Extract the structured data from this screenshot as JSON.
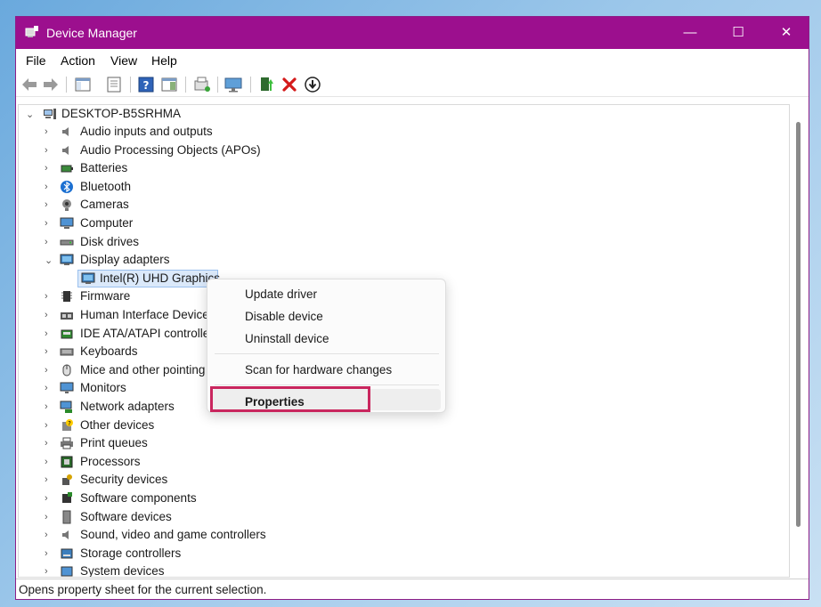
{
  "window": {
    "title": "Device Manager",
    "controls": {
      "minimize": "—",
      "maximize": "☐",
      "close": "✕"
    }
  },
  "menubar": [
    "File",
    "Action",
    "View",
    "Help"
  ],
  "toolbar": {
    "icons": [
      "back-icon",
      "forward-icon",
      "show-hide-console-tree-icon",
      "properties-icon",
      "help-icon",
      "action-pane-icon",
      "scan-hardware-icon",
      "monitor-icon",
      "update-driver-icon",
      "uninstall-icon",
      "download-icon"
    ]
  },
  "tree": {
    "root": "DESKTOP-B5SRHMA",
    "categories": [
      {
        "label": "Audio inputs and outputs",
        "icon": "speaker-icon",
        "expanded": false
      },
      {
        "label": "Audio Processing Objects (APOs)",
        "icon": "speaker-icon",
        "expanded": false
      },
      {
        "label": "Batteries",
        "icon": "battery-icon",
        "expanded": false
      },
      {
        "label": "Bluetooth",
        "icon": "bluetooth-icon",
        "expanded": false
      },
      {
        "label": "Cameras",
        "icon": "camera-icon",
        "expanded": false
      },
      {
        "label": "Computer",
        "icon": "computer-icon",
        "expanded": false
      },
      {
        "label": "Disk drives",
        "icon": "disk-icon",
        "expanded": false
      },
      {
        "label": "Display adapters",
        "icon": "display-icon",
        "expanded": true,
        "children": [
          "Intel(R) UHD Graphics"
        ]
      },
      {
        "label": "Firmware",
        "icon": "chip-icon",
        "expanded": false
      },
      {
        "label": "Human Interface Devices",
        "icon": "hid-icon",
        "expanded": false
      },
      {
        "label": "IDE ATA/ATAPI controllers",
        "icon": "ide-icon",
        "expanded": false
      },
      {
        "label": "Keyboards",
        "icon": "keyboard-icon",
        "expanded": false
      },
      {
        "label": "Mice and other pointing devices",
        "icon": "mouse-icon",
        "expanded": false
      },
      {
        "label": "Monitors",
        "icon": "monitor-icon",
        "expanded": false
      },
      {
        "label": "Network adapters",
        "icon": "network-icon",
        "expanded": false
      },
      {
        "label": "Other devices",
        "icon": "unknown-device-icon",
        "expanded": false
      },
      {
        "label": "Print queues",
        "icon": "printer-icon",
        "expanded": false
      },
      {
        "label": "Processors",
        "icon": "processor-icon",
        "expanded": false
      },
      {
        "label": "Security devices",
        "icon": "security-icon",
        "expanded": false
      },
      {
        "label": "Software components",
        "icon": "software-component-icon",
        "expanded": false
      },
      {
        "label": "Software devices",
        "icon": "software-device-icon",
        "expanded": false
      },
      {
        "label": "Sound, video and game controllers",
        "icon": "speaker-icon",
        "expanded": false
      },
      {
        "label": "Storage controllers",
        "icon": "storage-icon",
        "expanded": false
      },
      {
        "label": "System devices",
        "icon": "system-icon",
        "expanded": false
      }
    ]
  },
  "context_menu": {
    "items": [
      "Update driver",
      "Disable device",
      "Uninstall device",
      "Scan for hardware changes",
      "Properties"
    ],
    "highlighted": "Properties"
  },
  "status_bar": "Opens property sheet for the current selection.",
  "colors": {
    "titlebar": "#9c0f8e",
    "annotation_box": "#c9265e",
    "selection": "#dbe9fa"
  }
}
